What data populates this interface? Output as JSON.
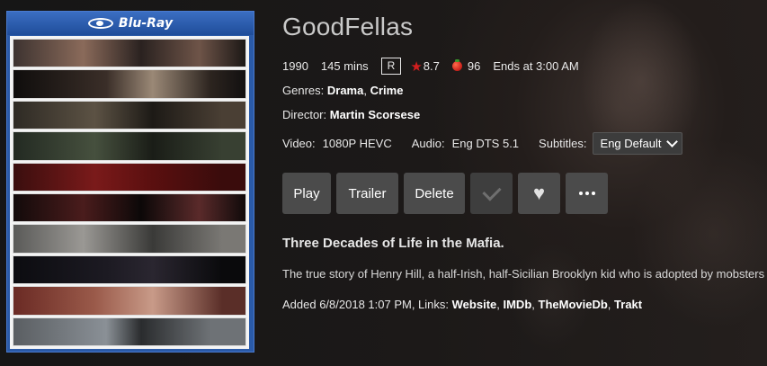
{
  "poster": {
    "format_label": "Blu-Ray"
  },
  "movie": {
    "title": "GoodFellas",
    "year": "1990",
    "runtime": "145 mins",
    "rating": "R",
    "community_rating": "8.7",
    "critic_rating": "96",
    "ends_at": "Ends at 3:00 AM"
  },
  "genres": {
    "label": "Genres:",
    "values": [
      "Drama",
      "Crime"
    ],
    "separator": ", "
  },
  "director": {
    "label": "Director:",
    "name": "Martin Scorsese"
  },
  "tech": {
    "video_label": "Video:",
    "video_value": "1080P HEVC",
    "audio_label": "Audio:",
    "audio_value": "Eng DTS 5.1",
    "subtitles_label": "Subtitles:",
    "subtitles_value": "Eng Default"
  },
  "buttons": {
    "play": "Play",
    "trailer": "Trailer",
    "delete": "Delete",
    "watched_icon": "check-icon",
    "favorite_icon": "heart-icon",
    "more_icon": "more-icon"
  },
  "tagline": "Three Decades of Life in the Mafia.",
  "overview": "The true story of Henry Hill, a half-Irish, half-Sicilian Brooklyn kid who is adopted by mobsters",
  "footer": {
    "added_text": "Added 6/8/2018 1:07 PM, Links: ",
    "links": [
      "Website",
      "IMDb",
      "TheMovieDb",
      "Trakt"
    ],
    "separator": ", "
  },
  "colors": {
    "star": "#d21e1e",
    "button_bg": "#4b4b4b",
    "poster_border": "#2a5aa8"
  }
}
